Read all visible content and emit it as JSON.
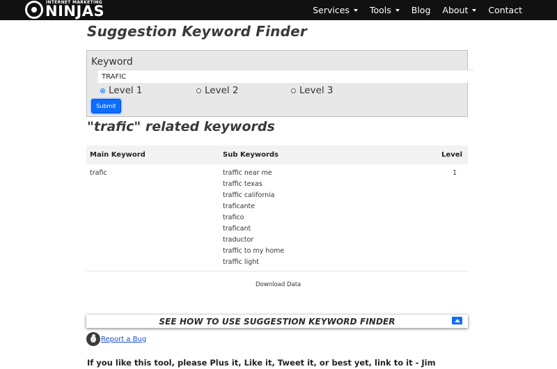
{
  "header": {
    "logo_small": "INTERNET MARKETING",
    "logo_big": "NINJAS",
    "nav": [
      {
        "label": "Services",
        "dropdown": true
      },
      {
        "label": "Tools",
        "dropdown": true
      },
      {
        "label": "Blog",
        "dropdown": false
      },
      {
        "label": "About",
        "dropdown": true
      },
      {
        "label": "Contact",
        "dropdown": false
      }
    ]
  },
  "page": {
    "title": "Suggestion Keyword Finder"
  },
  "form": {
    "keyword_label": "Keyword",
    "keyword_value": "TRAFIC",
    "levels": [
      {
        "label": "Level 1",
        "checked": true
      },
      {
        "label": "Level 2",
        "checked": false
      },
      {
        "label": "Level 3",
        "checked": false
      }
    ],
    "submit_label": "Submit"
  },
  "results": {
    "title": "\"trafic\" related keywords",
    "columns": {
      "main": "Main Keyword",
      "sub": "Sub Keywords",
      "level": "Level"
    },
    "rows": [
      {
        "main": "trafic",
        "level": "1",
        "subs": [
          "traffic near me",
          "traffic texas",
          "traffic california",
          "traficante",
          "trafico",
          "traficant",
          "traductor",
          "traffic to my home",
          "traffic light"
        ]
      }
    ],
    "download_label": "Download Data"
  },
  "howto": {
    "label": "SEE HOW TO USE SUGGESTION KEYWORD FINDER"
  },
  "bug": {
    "label": "Report a Bug"
  },
  "footer": {
    "text": "If you like this tool, please Plus it, Like it, Tweet it, or best yet, link to it - Jim"
  },
  "colors": {
    "nav_bg": "#111111",
    "accent": "#0d6efd",
    "form_bg": "#e8e8e8",
    "table_header_bg": "#f2f2f2",
    "link": "#1a4fd1"
  },
  "icons": {
    "logo": "swirl-logo-icon",
    "caret": "chevron-down-icon",
    "howto_toggle": "arrow-up-icon",
    "bug": "bug-icon"
  }
}
